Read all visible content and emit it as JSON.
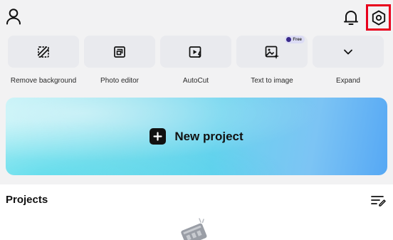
{
  "header": {
    "profile_icon": "person-icon",
    "notification_icon": "bell-icon",
    "settings_icon": "hexagon-settings-icon",
    "highlight_color": "#e8001c"
  },
  "tools": [
    {
      "label": "Remove background",
      "icon": "remove-background-icon"
    },
    {
      "label": "Photo editor",
      "icon": "photo-editor-icon"
    },
    {
      "label": "AutoCut",
      "icon": "autocut-icon"
    },
    {
      "label": "Text to image",
      "icon": "text-to-image-icon",
      "badge": "Free"
    },
    {
      "label": "Expand",
      "icon": "chevron-down-icon"
    }
  ],
  "new_project": {
    "label": "New project",
    "icon": "plus-icon"
  },
  "projects": {
    "title": "Projects",
    "menu_icon": "list-edit-icon"
  }
}
